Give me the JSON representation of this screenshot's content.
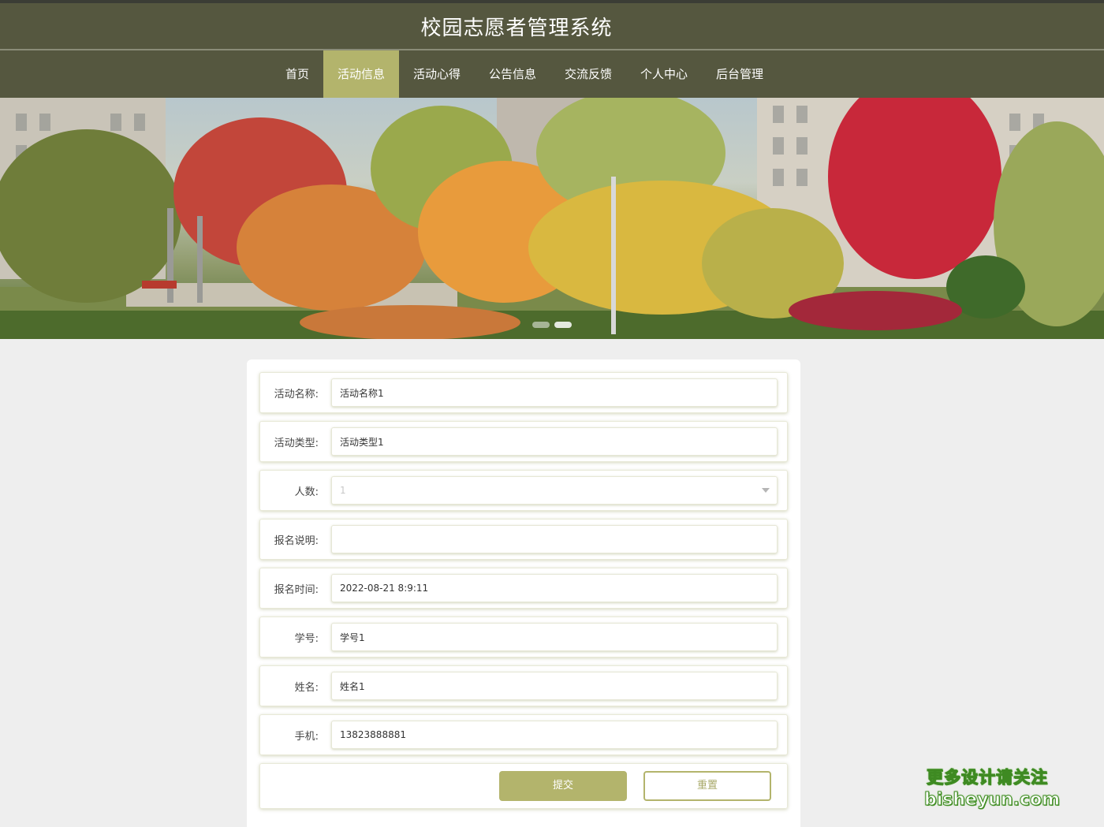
{
  "header": {
    "title": "校园志愿者管理系统"
  },
  "nav": {
    "items": [
      {
        "label": "首页",
        "active": false
      },
      {
        "label": "活动信息",
        "active": true
      },
      {
        "label": "活动心得",
        "active": false
      },
      {
        "label": "公告信息",
        "active": false
      },
      {
        "label": "交流反馈",
        "active": false
      },
      {
        "label": "个人中心",
        "active": false
      },
      {
        "label": "后台管理",
        "active": false
      }
    ]
  },
  "banner": {
    "slide_count": 2,
    "active_slide": 1
  },
  "form": {
    "activity_name": {
      "label": "活动名称:",
      "value": "活动名称1"
    },
    "activity_type": {
      "label": "活动类型:",
      "value": "活动类型1"
    },
    "headcount": {
      "label": "人数:",
      "value": "1"
    },
    "signup_note": {
      "label": "报名说明:",
      "value": ""
    },
    "signup_time": {
      "label": "报名时间:",
      "value": "2022-08-21 8:9:11"
    },
    "student_id": {
      "label": "学号:",
      "value": "学号1"
    },
    "name": {
      "label": "姓名:",
      "value": "姓名1"
    },
    "phone": {
      "label": "手机:",
      "value": "13823888881"
    },
    "submit_label": "提交",
    "reset_label": "重置"
  },
  "watermark": {
    "line1": "更多设计请关注",
    "line2": "bisheyun.com"
  },
  "colors": {
    "header_bg": "#55573f",
    "accent": "#b3b46c",
    "page_bg": "#eeeeee"
  }
}
